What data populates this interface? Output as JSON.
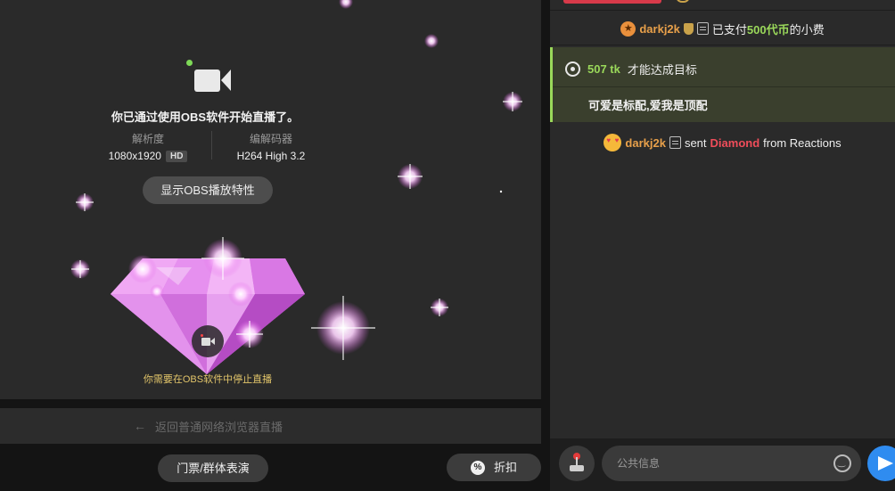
{
  "stream": {
    "obs_message": "你已通过使用OBS软件开始直播了。",
    "resolution_label": "解析度",
    "resolution_value": "1080x1920",
    "hd_badge": "HD",
    "codec_label": "编解码器",
    "codec_value": "H264 High 3.2",
    "obs_props_button": "显示OBS播放特性",
    "stop_note": "你需要在OBS软件中停止直播"
  },
  "back_bar": {
    "arrow": "←",
    "label": "返回普通网络浏览器直播"
  },
  "bottom": {
    "ticket_button": "门票/群体表演",
    "discount_button": "折扣",
    "discount_icon": "%"
  },
  "chat": {
    "tip_message": {
      "username": "darkj2k",
      "text_before": "已支付",
      "amount": "500代币",
      "text_after": "的小费",
      "star_icon": "★"
    },
    "goal": {
      "tokens": "507 tk",
      "label": "才能达成目标",
      "description": "可爱是标配,爱我是顶配"
    },
    "reaction_message": {
      "username": "darkj2k",
      "sent": "sent",
      "item": "Diamond",
      "from": "from Reactions"
    },
    "input_placeholder": "公共信息"
  },
  "colors": {
    "accent_green": "#9ad85a",
    "username_orange": "#e8a04a",
    "diamond_red": "#f04d5a",
    "send_blue": "#2f8cf0",
    "diamond_pink": "#e27bea"
  }
}
